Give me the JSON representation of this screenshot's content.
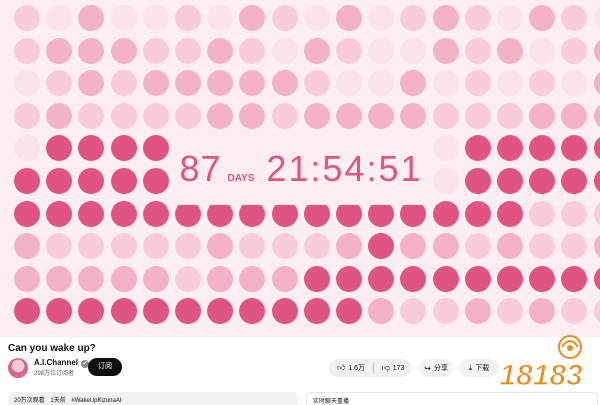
{
  "colors": {
    "background": "#fdeef2",
    "dot_light": "#fbe3ea",
    "dot_mid": "#f4b3c5",
    "dot_dark": "#e0557f",
    "countdown_text": "#e0557f"
  },
  "dot_grid": {
    "rows": [
      [
        1,
        0,
        2,
        0,
        0,
        1,
        0,
        2,
        1,
        0,
        2,
        0,
        1,
        2,
        1,
        0,
        2,
        1,
        0
      ],
      [
        1,
        2,
        2,
        2,
        1,
        1,
        2,
        1,
        0,
        2,
        1,
        0,
        0,
        2,
        1,
        2,
        0,
        1,
        2
      ],
      [
        0,
        1,
        2,
        1,
        2,
        2,
        2,
        2,
        2,
        1,
        0,
        0,
        2,
        0,
        1,
        0,
        1,
        0,
        2
      ],
      [
        1,
        2,
        1,
        1,
        1,
        1,
        2,
        2,
        1,
        2,
        2,
        2,
        2,
        1,
        1,
        1,
        2,
        2,
        2
      ],
      [
        0,
        3,
        3,
        3,
        3,
        0,
        0,
        0,
        0,
        0,
        0,
        0,
        0,
        0,
        3,
        3,
        3,
        3,
        3
      ],
      [
        3,
        3,
        3,
        3,
        3,
        0,
        0,
        0,
        0,
        0,
        0,
        0,
        0,
        0,
        3,
        3,
        3,
        3,
        3
      ],
      [
        3,
        3,
        3,
        3,
        3,
        3,
        3,
        3,
        3,
        3,
        3,
        3,
        3,
        3,
        3,
        3,
        1,
        1,
        1
      ],
      [
        2,
        1,
        1,
        1,
        1,
        1,
        2,
        1,
        1,
        1,
        2,
        3,
        2,
        2,
        1,
        2,
        1,
        1,
        2
      ],
      [
        2,
        2,
        2,
        2,
        2,
        1,
        2,
        2,
        2,
        3,
        3,
        3,
        3,
        3,
        3,
        3,
        3,
        3,
        3
      ],
      [
        3,
        3,
        3,
        3,
        3,
        3,
        3,
        3,
        3,
        3,
        3,
        2,
        1,
        1,
        2,
        1,
        2,
        1,
        1
      ]
    ]
  },
  "countdown": {
    "days_value": "87",
    "days_label": "DAYS",
    "time": "21:54:51"
  },
  "video": {
    "title": "Can you wake up?"
  },
  "channel": {
    "name": "A.I.Channel",
    "subscribers": "298万位订阅者",
    "subscribe_label": "订阅"
  },
  "actions": {
    "like_count": "1.6万",
    "dislike_count": "173",
    "share_label": "分享",
    "download_label": "下载"
  },
  "description": {
    "views": "20万次观看",
    "time_ago": "1天前",
    "hashtag": "#WakeUpKizunaAI"
  },
  "chat": {
    "label": "实时聊天重播"
  },
  "watermark": {
    "text": "18183"
  }
}
